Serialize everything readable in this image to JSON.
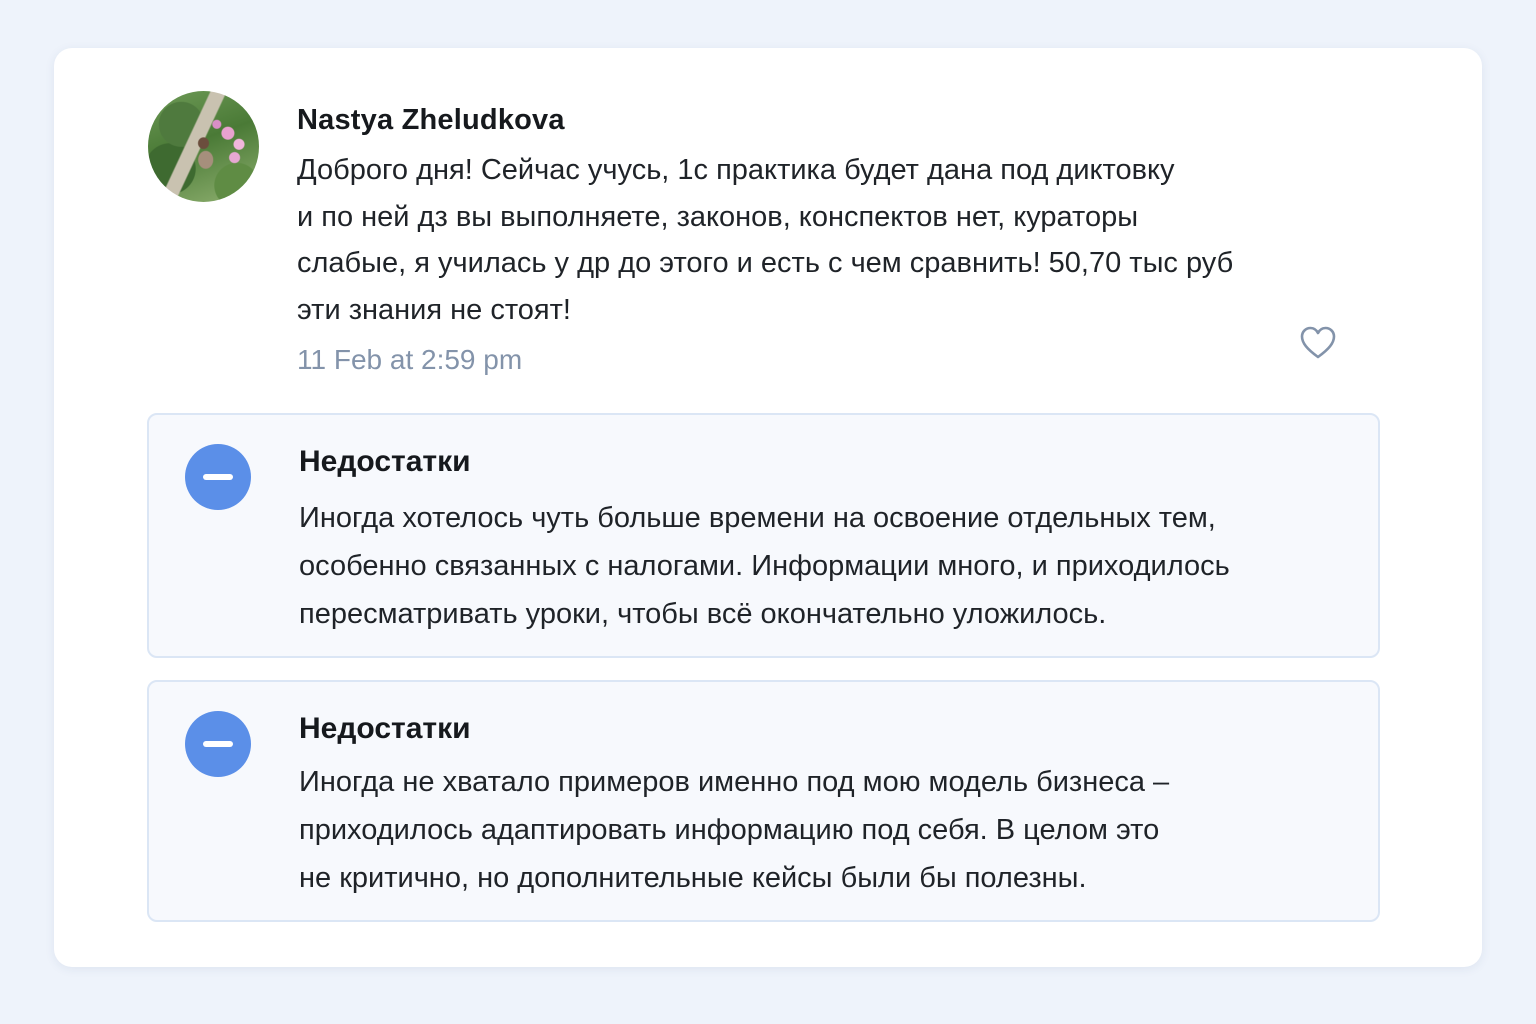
{
  "review": {
    "author": "Nastya Zheludkova",
    "text": "Доброго дня! Сейчас учусь, 1с практика будет дана под диктовку\nи по ней дз вы выполняете, законов, конспектов нет, кураторы\nслабые, я училась у др до этого и есть с чем сравнить! 50,70 тыс руб\nэти знания не стоят!",
    "date": "11 Feb at 2:59 pm",
    "like_icon": "heart-outline-icon"
  },
  "drawbacks": [
    {
      "icon": "minus-circle-icon",
      "title": "Недостатки",
      "text": "Иногда хотелось чуть больше времени на освоение отдельных тем,\nособенно связанных с налогами. Информации много, и приходилось\nпересматривать уроки, чтобы всё окончательно уложилось."
    },
    {
      "icon": "minus-circle-icon",
      "title": "Недостатки",
      "text": "Иногда не хватало примеров именно под мою модель бизнеса –\nприходилось адаптировать информацию под себя. В целом это\nне критично, но дополнительные кейсы были бы полезны."
    }
  ],
  "colors": {
    "page_background": "#eef3fb",
    "card_background": "#ffffff",
    "accent_blue": "#5b8fe8",
    "date_gray": "#8393aa",
    "block_border": "#dbe6f5"
  }
}
